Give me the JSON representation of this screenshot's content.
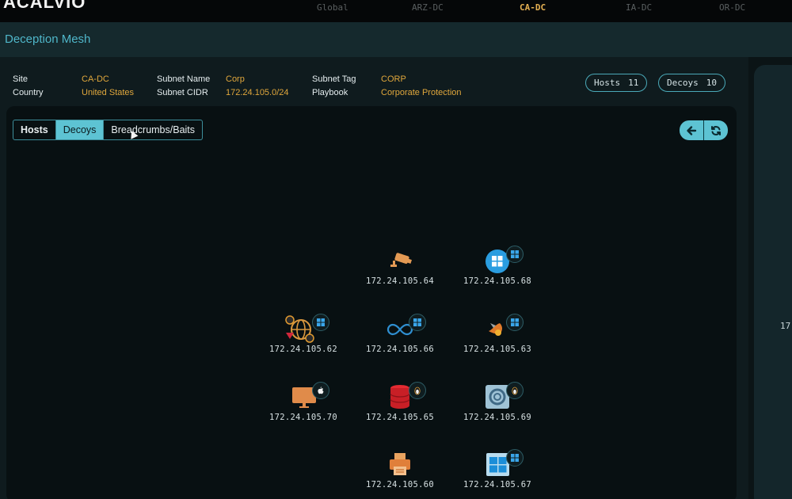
{
  "app": {
    "logo": "ACALVIO"
  },
  "nav": {
    "tabs": [
      "Global",
      "ARZ-DC",
      "CA-DC",
      "IA-DC",
      "OR-DC"
    ],
    "active": "CA-DC"
  },
  "page": {
    "title": "Deception Mesh"
  },
  "info": {
    "site_label": "Site",
    "site_value": "CA-DC",
    "country_label": "Country",
    "country_value": "United States",
    "subnet_name_label": "Subnet Name",
    "subnet_name_value": "Corp",
    "subnet_cidr_label": "Subnet CIDR",
    "subnet_cidr_value": "172.24.105.0/24",
    "subnet_tag_label": "Subnet Tag",
    "subnet_tag_value": "CORP",
    "playbook_label": "Playbook",
    "playbook_value": "Corporate Protection"
  },
  "counters": {
    "hosts_label": "Hosts",
    "hosts_count": "11",
    "decoys_label": "Decoys",
    "decoys_count": "10"
  },
  "view_tabs": [
    {
      "label": "Hosts",
      "active": false
    },
    {
      "label": "Decoys",
      "active": true
    },
    {
      "label": "Breadcrumbs/Baits",
      "active": false
    }
  ],
  "controls": {
    "back_icon": "arrow-left-icon",
    "refresh_icon": "refresh-icon"
  },
  "side_panel": {
    "visible_text": "17"
  },
  "colors": {
    "accent": "#5dc3d3",
    "value": "#e0a73c",
    "active_nav": "#e4b052"
  },
  "decoys": [
    {
      "ip": "172.24.105.64",
      "icon": "camera-icon",
      "os": ""
    },
    {
      "ip": "172.24.105.68",
      "icon": "windows-icon",
      "os": "windows"
    },
    {
      "ip": "172.24.105.62",
      "icon": "globe-services-icon",
      "os": "windows"
    },
    {
      "ip": "172.24.105.66",
      "icon": "infinity-icon",
      "os": "windows"
    },
    {
      "ip": "172.24.105.63",
      "icon": "bird-icon",
      "os": "windows"
    },
    {
      "ip": "172.24.105.70",
      "icon": "monitor-icon",
      "os": "apple"
    },
    {
      "ip": "172.24.105.65",
      "icon": "database-icon",
      "os": "linux"
    },
    {
      "ip": "172.24.105.69",
      "icon": "debian-icon",
      "os": "linux"
    },
    {
      "ip": "172.24.105.60",
      "icon": "printer-icon",
      "os": ""
    },
    {
      "ip": "172.24.105.67",
      "icon": "windows-tile-icon",
      "os": "windows"
    }
  ]
}
